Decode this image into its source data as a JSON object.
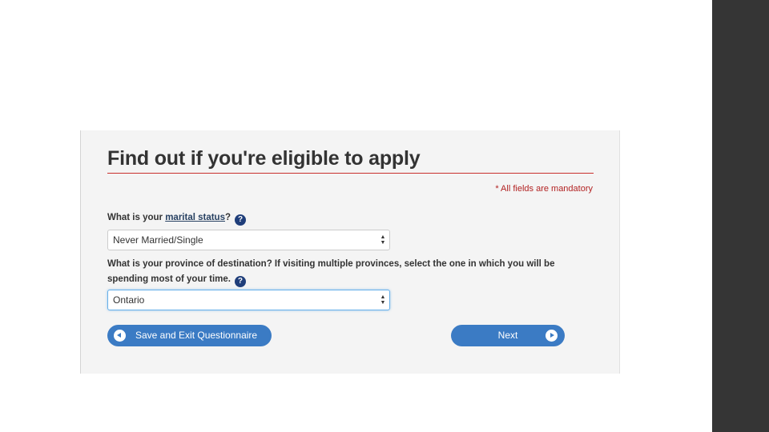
{
  "form": {
    "title": "Find out if you're eligible to apply",
    "mandatory_note": "* All fields are mandatory",
    "q1": {
      "prefix": "What is your ",
      "link": "marital status",
      "suffix": "?",
      "selected": "Never Married/Single"
    },
    "q2": {
      "text": "What is your province of destination? If visiting multiple provinces, select the one in which you will be spending most of your time.",
      "selected": "Ontario"
    },
    "help_glyph": "?",
    "buttons": {
      "save_exit": "Save and Exit Questionnaire",
      "next": "Next"
    }
  },
  "icons": {
    "help": "question-circle-icon",
    "back": "arrow-left-circle-icon",
    "next": "arrow-right-circle-icon",
    "select": "chevron-up-down-icon"
  },
  "colors": {
    "accent": "#3b7bc4",
    "title_rule": "#c9302c",
    "mandatory": "#b22222",
    "help_icon": "#1f3e7a",
    "sidebar": "#353535"
  }
}
